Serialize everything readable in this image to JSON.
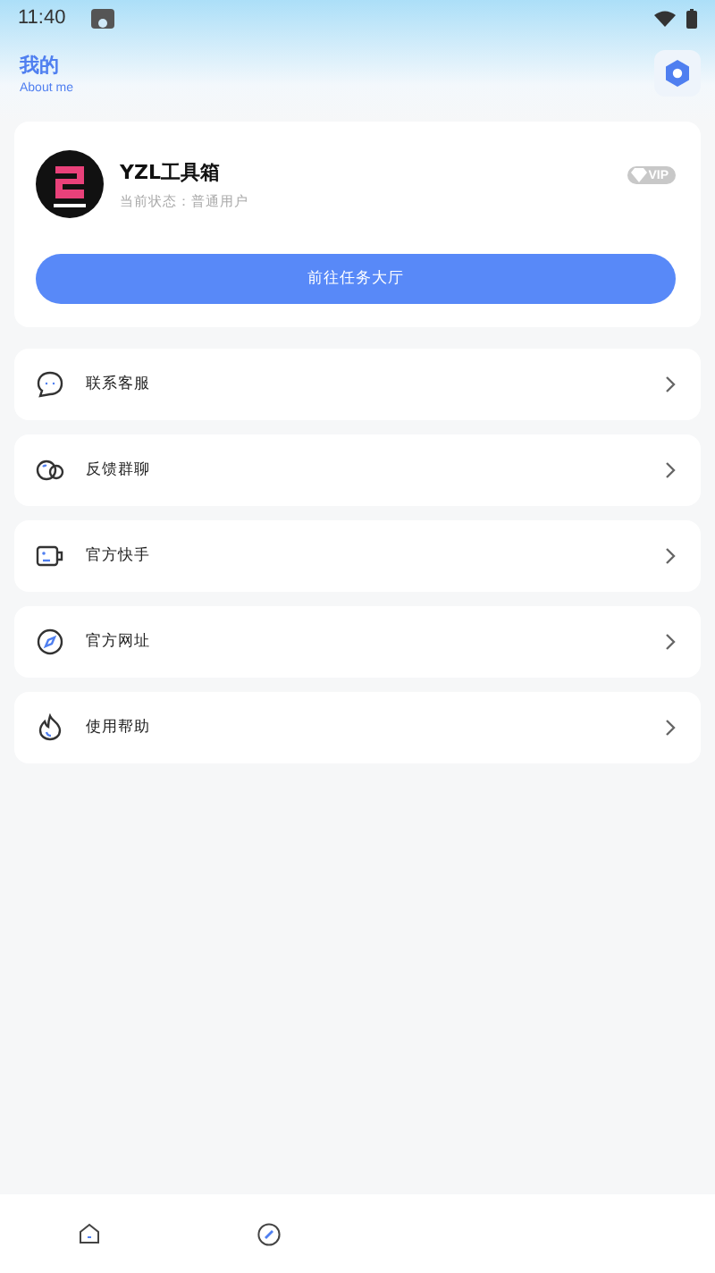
{
  "status_bar": {
    "time": "11:40"
  },
  "header": {
    "title": "我的",
    "subtitle": "About me"
  },
  "profile": {
    "name": "YZL工具箱",
    "status": "当前状态：普通用户",
    "badge": "VIP",
    "button": "前往任务大厅"
  },
  "menu": [
    {
      "label": "联系客服",
      "kind": "chat"
    },
    {
      "label": "反馈群聊",
      "kind": "group"
    },
    {
      "label": "官方快手",
      "kind": "video"
    },
    {
      "label": "官方网址",
      "kind": "compass"
    },
    {
      "label": "使用帮助",
      "kind": "help"
    }
  ],
  "bottom_nav": [
    {
      "kind": "home",
      "selected": false
    },
    {
      "kind": "compass",
      "selected": false
    }
  ]
}
